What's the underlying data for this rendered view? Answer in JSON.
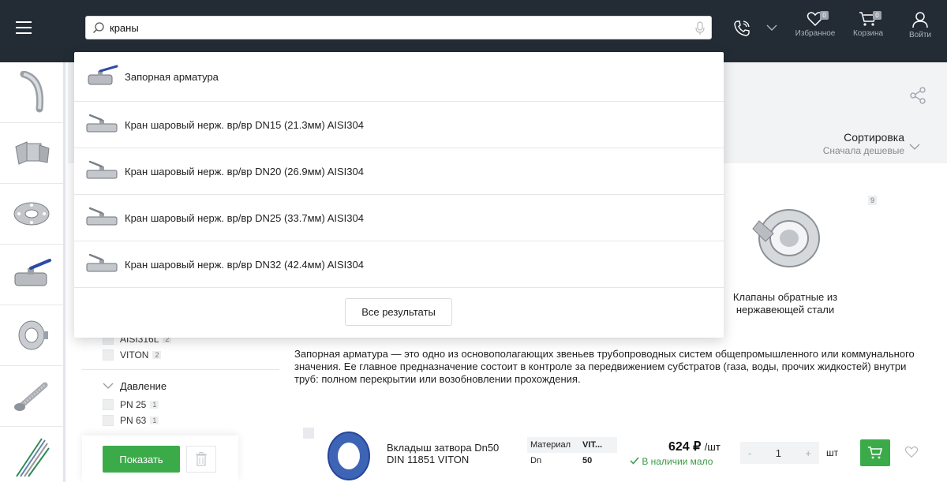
{
  "header": {
    "search": {
      "value": "краны"
    },
    "favorites": {
      "label": "Избранное",
      "count": "0"
    },
    "cart": {
      "label": "Корзина",
      "count": "0"
    },
    "login": {
      "label": "Войти"
    }
  },
  "dropdown": {
    "suggestions": [
      {
        "label": "Запорная арматура",
        "icon": "ball-valve-icon"
      },
      {
        "label": "Кран шаровый нерж. вр/вр DN15 (21.3мм) AISI304",
        "icon": "ball-valve-icon"
      },
      {
        "label": "Кран шаровый нерж. вр/вр DN20 (26.9мм) AISI304",
        "icon": "ball-valve-icon"
      },
      {
        "label": "Кран шаровый нерж. вр/вр DN25 (33.7мм) AISI304",
        "icon": "ball-valve-icon"
      },
      {
        "label": "Кран шаровый нерж. вр/вр DN32 (42.4мм) AISI304",
        "icon": "ball-valve-icon"
      }
    ],
    "all_results_label": "Все результаты"
  },
  "sort": {
    "title": "Сортировка",
    "value": "Сначала дешевые"
  },
  "category_card": {
    "count": "9",
    "name": "Клапаны обратные из нержавеющей стали"
  },
  "filters": {
    "material_items": [
      {
        "label": "AISI316L",
        "count": "2"
      },
      {
        "label": "VITON",
        "count": "2"
      }
    ],
    "pressure": {
      "title": "Давление",
      "items": [
        {
          "label": "PN 25",
          "count": "1"
        },
        {
          "label": "PN 63",
          "count": "1"
        }
      ]
    },
    "show_label": "Показать"
  },
  "description": "Запорная арматура — это одно из основополагающих звеньев трубопроводных систем общепромышленного или коммунального значения. Ее главное предназначение состоит в контроле за передвижением субстратов (газа, воды, прочих жидкостей) внутри труб: полном перекрытии или возобновлении прохождения.",
  "product": {
    "name": "Вкладыш затвора Dn50 DIN 11851 VITON",
    "specs": [
      {
        "key": "Материал",
        "value": "VIT..."
      },
      {
        "key": "Dn",
        "value": "50"
      }
    ],
    "price": "624",
    "currency": "₽",
    "per_unit": "/шт",
    "stock": "В наличии мало",
    "qty": "1",
    "unit": "шт",
    "minus": "-",
    "plus": "+"
  },
  "colors": {
    "header_bg": "#232c35",
    "accent_green": "#3bab4a"
  }
}
